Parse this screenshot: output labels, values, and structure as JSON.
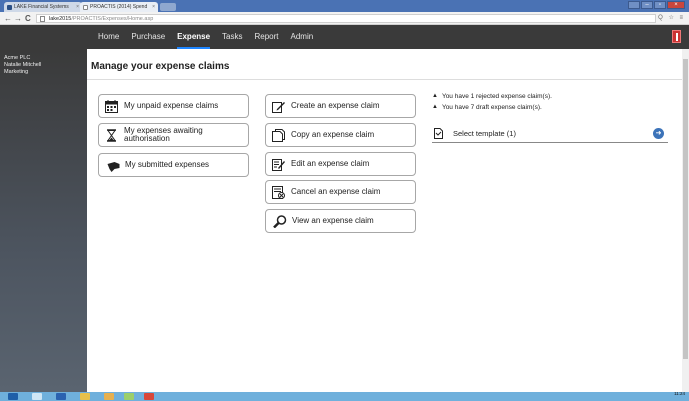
{
  "browser": {
    "tabs": [
      {
        "label": "LAKE Financial Systems"
      },
      {
        "label": "PROACTIS (2014) Spend"
      }
    ],
    "address": {
      "host": "lake2015",
      "path": "/PROACTIS/Expenses/Home.asp"
    },
    "nav": {
      "back": "←",
      "forward": "→",
      "reload": "C"
    },
    "right_icons": "Q ☆ ≡"
  },
  "app_nav": {
    "items": [
      {
        "label": "Home",
        "active": false
      },
      {
        "label": "Purchase",
        "active": false
      },
      {
        "label": "Expense",
        "active": true
      },
      {
        "label": "Tasks",
        "active": false
      },
      {
        "label": "Report",
        "active": false
      },
      {
        "label": "Admin",
        "active": false
      }
    ]
  },
  "sidebar": {
    "company": "Acme PLC",
    "user": "Natalie Mitchell",
    "department": "Marketing"
  },
  "main": {
    "title": "Manage your expense claims",
    "left_buttons": [
      {
        "label": "My unpaid expense claims",
        "icon": "calendar-icon"
      },
      {
        "label": "My expenses awaiting authorisation",
        "icon": "hourglass-icon"
      },
      {
        "label": "My submitted expenses",
        "icon": "hand-icon"
      }
    ],
    "right_buttons": [
      {
        "label": "Create an expense claim",
        "icon": "create-icon"
      },
      {
        "label": "Copy an expense claim",
        "icon": "copy-icon"
      },
      {
        "label": "Edit an expense claim",
        "icon": "edit-icon"
      },
      {
        "label": "Cancel an expense claim",
        "icon": "cancel-icon"
      },
      {
        "label": "View an expense claim",
        "icon": "view-icon"
      }
    ],
    "notices": [
      "You have 1 rejected expense claim(s).",
      "You have 7 draft expense claim(s)."
    ],
    "template": {
      "label": "Select template (1)"
    }
  },
  "taskbar": {
    "time": "11:24"
  },
  "colors": {
    "nav_bg": "#3a3a3a",
    "accent": "#1f86ff",
    "taskbar": "#6fb0dc"
  }
}
